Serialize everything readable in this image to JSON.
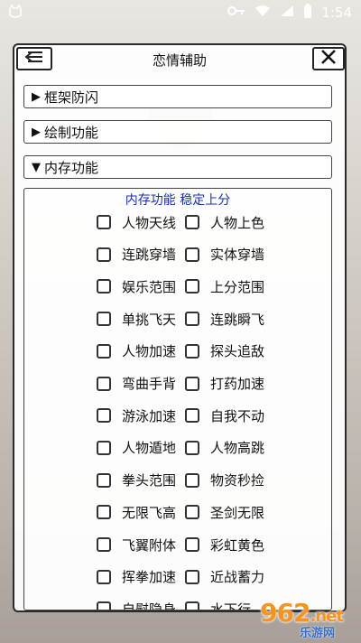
{
  "status_bar": {
    "time": "1:54",
    "icons": [
      "key-icon",
      "wifi-icon",
      "signal-icon",
      "battery-icon"
    ]
  },
  "panel": {
    "title": "恋情辅助",
    "back_icon": "back-arrow-icon",
    "close_icon": "close-icon"
  },
  "sections": [
    {
      "label": "框架防闪",
      "arrow": "▶"
    },
    {
      "label": "绘制功能",
      "arrow": "▶"
    },
    {
      "label": "内存功能",
      "arrow": "▼"
    }
  ],
  "memory": {
    "title": "内存功能 稳定上分",
    "options": [
      [
        "人物天线",
        "人物上色"
      ],
      [
        "连跳穿墙",
        "实体穿墙"
      ],
      [
        "娱乐范围",
        "上分范围"
      ],
      [
        "单挑飞天",
        "连跳瞬飞"
      ],
      [
        "人物加速",
        "探头追敌"
      ],
      [
        "弯曲手背",
        "打药加速"
      ],
      [
        "游泳加速",
        "自我不动"
      ],
      [
        "人物遁地",
        "人物高跳"
      ],
      [
        "拳头范围",
        "物资秒捡"
      ],
      [
        "无限飞高",
        "圣剑无限"
      ],
      [
        "飞翼附体",
        "彩虹黄色"
      ],
      [
        "挥拳加速",
        "近战蓄力"
      ],
      [
        "自慰隐身",
        "水下行"
      ]
    ]
  },
  "watermark": {
    "number": "962",
    "suffix": ".net",
    "site": "乐游网"
  },
  "colors": {
    "accent_title": "#1a2fb8",
    "watermark_orange": "#f7931e",
    "watermark_blue": "#2f6fd6"
  }
}
